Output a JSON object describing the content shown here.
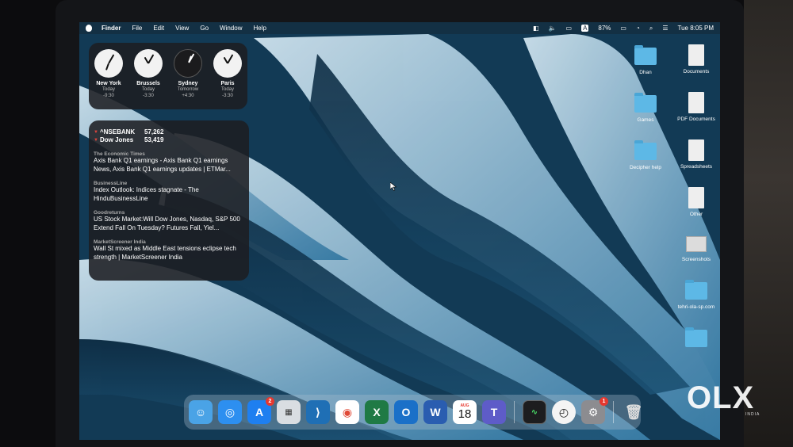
{
  "menubar": {
    "app": "Finder",
    "items": [
      "File",
      "Edit",
      "View",
      "Go",
      "Window",
      "Help"
    ],
    "keyboard": "A",
    "battery": "87%",
    "datetime": "Tue 8:05 PM"
  },
  "clocks": [
    {
      "city": "New York",
      "day": "Today",
      "offset": "-9:30",
      "hour_angle": 200,
      "min_angle": 30,
      "dark": false
    },
    {
      "city": "Brussels",
      "day": "Today",
      "offset": "-3:30",
      "hour_angle": 330,
      "min_angle": 30,
      "dark": false
    },
    {
      "city": "Sydney",
      "day": "Tomorrow",
      "offset": "+4:30",
      "hour_angle": 20,
      "min_angle": 30,
      "dark": true
    },
    {
      "city": "Paris",
      "day": "Today",
      "offset": "-3:30",
      "hour_angle": 330,
      "min_angle": 30,
      "dark": false
    }
  ],
  "stocks": [
    {
      "symbol": "^NSEBANK",
      "value": "57,262"
    },
    {
      "symbol": "Dow Jones",
      "value": "53,419"
    }
  ],
  "news": [
    {
      "source": "The Economic Times",
      "headline": "Axis Bank Q1 earnings - Axis Bank Q1 earnings News, Axis Bank Q1 earnings updates | ETMar..."
    },
    {
      "source": "BusinessLine",
      "headline": "Index Outlook: Indices stagnate - The HinduBusinessLine"
    },
    {
      "source": "Goodreturns",
      "headline": "US Stock Market:Will Dow Jones, Nasdaq, S&P 500 Extend Fall On Tuesday? Futures Fall, Yiel..."
    },
    {
      "source": "MarketScreener India",
      "headline": "Wall St mixed as Middle East tensions eclipse tech strength | MarketScreener India"
    }
  ],
  "desktop": {
    "dhan": "Dhan",
    "documents": "Documents",
    "games": "Games",
    "pdf": "PDF Documents",
    "decipher": "Decipher help",
    "spreadsheets": "Spreadsheets",
    "other": "Other",
    "screenshots": "Screenshots",
    "tehri": "tehri-ola-sp.com"
  },
  "dock": {
    "appstore_badge": "2",
    "calendar_month": "AUG",
    "calendar_day": "18",
    "settings_badge": "1"
  },
  "watermark": {
    "brand": "OLX",
    "country": "INDIA"
  }
}
